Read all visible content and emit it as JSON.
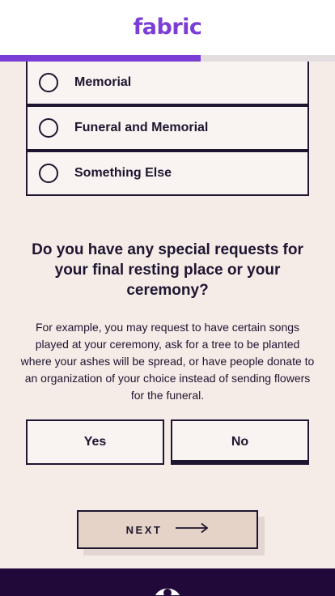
{
  "header": {
    "logo": "fabric"
  },
  "progress": {
    "fraction": 0.6
  },
  "options": [
    {
      "label": "Memorial"
    },
    {
      "label": "Funeral and Memorial"
    },
    {
      "label": "Something Else"
    }
  ],
  "question": {
    "title": "Do you have any special requests for your final resting place or your ceremony?",
    "hint": "For example, you may request to have certain songs played at your ceremony, ask for a tree to be planted where your ashes will be spread, or have people donate to an organization of your choice instead of sending flowers for the funeral."
  },
  "answers": {
    "yes_label": "Yes",
    "no_label": "No",
    "selected": "No"
  },
  "next": {
    "label": "NEXT",
    "icon": "arrow-right-icon"
  },
  "footer": {
    "icon": "eye-icon"
  },
  "colors": {
    "brand": "#7a3ed6",
    "ink": "#1e1530",
    "background": "#f5ece8",
    "footer": "#210a3a",
    "next_button": "#e4d3c6"
  }
}
